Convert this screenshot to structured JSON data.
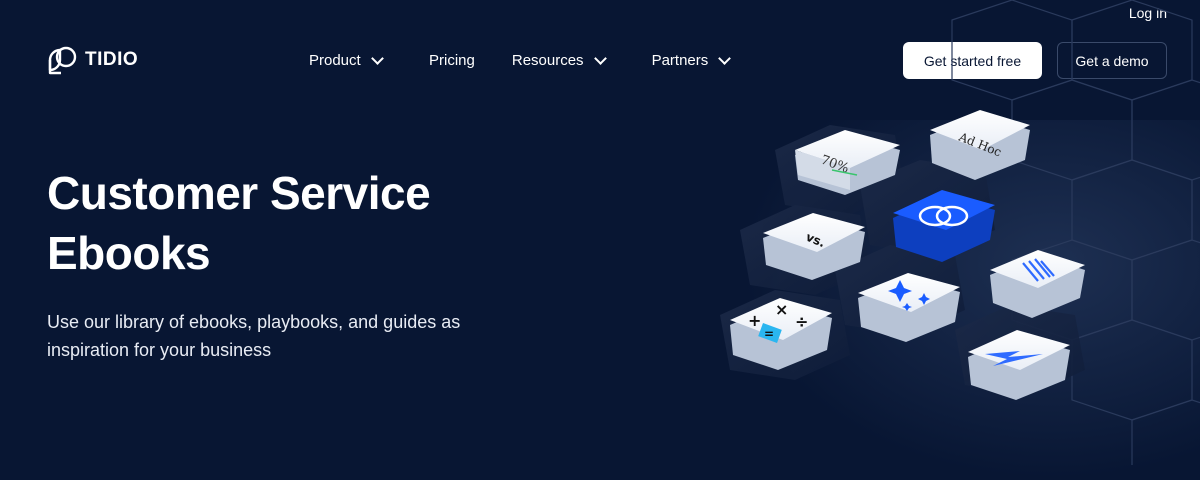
{
  "brand": {
    "name": "TIDIO"
  },
  "header": {
    "login_label": "Log in",
    "nav": [
      {
        "label": "Product",
        "has_dropdown": true
      },
      {
        "label": "Pricing",
        "has_dropdown": false
      },
      {
        "label": "Resources",
        "has_dropdown": true
      },
      {
        "label": "Partners",
        "has_dropdown": true
      }
    ],
    "cta_primary": "Get started free",
    "cta_secondary": "Get a demo"
  },
  "hero": {
    "title_line1": "Customer Service",
    "title_line2": "Ebooks",
    "subtitle": "Use our library of ebooks, playbooks, and guides as inspiration for your business"
  },
  "illustration": {
    "tiles": [
      {
        "icon": "percent-arrow-icon",
        "text": "70%"
      },
      {
        "icon": "ad-hoc-logo-icon",
        "text": "Ad Hoc"
      },
      {
        "icon": "versus-icon",
        "text": "vs."
      },
      {
        "icon": "tidio-rings-icon",
        "text": ""
      },
      {
        "icon": "diagonal-stripes-icon",
        "text": ""
      },
      {
        "icon": "sparkles-icon",
        "text": ""
      },
      {
        "icon": "calculator-icon",
        "text": ""
      },
      {
        "icon": "lightning-icon",
        "text": ""
      }
    ]
  },
  "colors": {
    "background": "#081633",
    "accent_blue": "#1a5cff",
    "white": "#ffffff"
  }
}
